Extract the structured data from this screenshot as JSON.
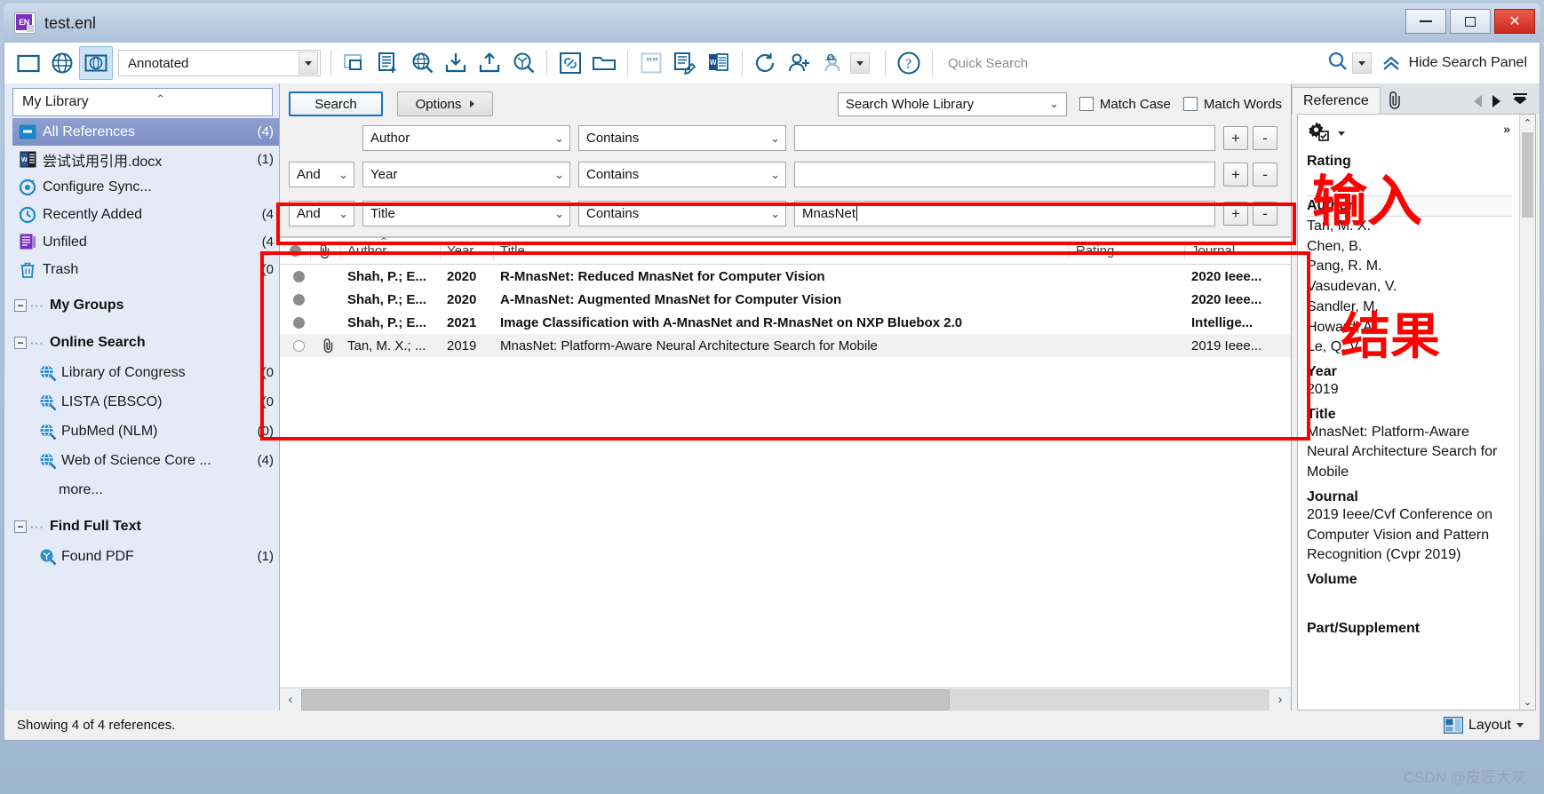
{
  "window": {
    "title": "test.enl",
    "app_badge": "EN",
    "minimize": "—",
    "maximize": "□",
    "close": "✕"
  },
  "toolbar": {
    "style_value": "Annotated",
    "quick_search_placeholder": "Quick Search",
    "hide_search_panel": "Hide Search Panel",
    "icons": [
      {
        "name": "new-library-icon",
        "glyph": "folder"
      },
      {
        "name": "online-search-icon",
        "glyph": "globe"
      },
      {
        "name": "integrated-library-search-icon",
        "glyph": "globe-folder"
      },
      {
        "name": "copy-references-icon",
        "glyph": "copy"
      },
      {
        "name": "new-reference-icon",
        "glyph": "doc-plus"
      },
      {
        "name": "online-search-mode-icon",
        "glyph": "globe-search"
      },
      {
        "name": "import-icon",
        "glyph": "down-arrow-tray"
      },
      {
        "name": "export-icon",
        "glyph": "up-arrow-tray"
      },
      {
        "name": "find-full-text-icon",
        "glyph": "pdf-search"
      },
      {
        "name": "open-url-link-icon",
        "glyph": "link"
      },
      {
        "name": "open-file-icon",
        "glyph": "open-folder"
      },
      {
        "name": "insert-citation-icon",
        "glyph": "quote"
      },
      {
        "name": "format-bibliography-icon",
        "glyph": "doc-pencil"
      },
      {
        "name": "word-addin-icon",
        "glyph": "word"
      },
      {
        "name": "sync-icon",
        "glyph": "sync"
      },
      {
        "name": "share-library-icon",
        "glyph": "person-plus"
      },
      {
        "name": "activity-feed-icon",
        "glyph": "person-bell"
      },
      {
        "name": "help-icon",
        "glyph": "question"
      }
    ]
  },
  "sidebar": {
    "library_header": "My Library",
    "items": [
      {
        "label": "All References",
        "count": "(4)",
        "icon": "all-references-icon",
        "selected": true
      },
      {
        "label": "尝试试用引用.docx",
        "count": "(1)",
        "icon": "word-doc-icon",
        "selected": false
      },
      {
        "label": "Configure Sync...",
        "count": "",
        "icon": "sync-config-icon",
        "selected": false
      },
      {
        "label": "Recently Added",
        "count": "(4",
        "icon": "recently-added-icon",
        "selected": false
      },
      {
        "label": "Unfiled",
        "count": "(4",
        "icon": "unfiled-icon",
        "selected": false
      },
      {
        "label": "Trash",
        "count": "(0",
        "icon": "trash-icon",
        "selected": false
      }
    ],
    "groups": [
      {
        "title": "My Groups",
        "children": []
      },
      {
        "title": "Online Search",
        "children": [
          {
            "label": "Library of Congress",
            "count": "(0",
            "icon": "online-search-icon"
          },
          {
            "label": "LISTA (EBSCO)",
            "count": "(0",
            "icon": "online-search-icon"
          },
          {
            "label": "PubMed (NLM)",
            "count": "(0)",
            "icon": "online-search-icon"
          },
          {
            "label": "Web of Science Core ...",
            "count": "(4)",
            "icon": "online-search-icon"
          }
        ],
        "more": "more..."
      },
      {
        "title": "Find Full Text",
        "children": [
          {
            "label": "Found PDF",
            "count": "(1)",
            "icon": "found-pdf-icon"
          }
        ]
      }
    ]
  },
  "search_panel": {
    "search_button": "Search",
    "options_button": "Options",
    "scope_value": "Search Whole Library",
    "match_case_label": "Match Case",
    "match_words_label": "Match Words",
    "rows": [
      {
        "bool": "",
        "field": "Author",
        "operator": "Contains",
        "term": "",
        "add": "+",
        "remove": "-"
      },
      {
        "bool": "And",
        "field": "Year",
        "operator": "Contains",
        "term": "",
        "add": "+",
        "remove": "-"
      },
      {
        "bool": "And",
        "field": "Title",
        "operator": "Contains",
        "term": "MnasNet",
        "add": "+",
        "remove": "-"
      }
    ]
  },
  "results_table": {
    "columns": [
      "",
      "",
      "Author",
      "Year",
      "Title",
      "Rating",
      "Journal"
    ],
    "column_labels": {
      "author": "Author",
      "year": "Year",
      "title": "Title",
      "rating": "Rating",
      "journal": "Journal"
    },
    "rows": [
      {
        "read": "unread",
        "attachment": false,
        "author": "Shah, P.; E...",
        "year": "2020",
        "title": "R-MnasNet: Reduced MnasNet for Computer Vision",
        "rating": "",
        "journal": "2020 Ieee...",
        "selected": false
      },
      {
        "read": "unread",
        "attachment": false,
        "author": "Shah, P.; E...",
        "year": "2020",
        "title": "A-MnasNet: Augmented MnasNet for Computer Vision",
        "rating": "",
        "journal": "2020 Ieee...",
        "selected": false
      },
      {
        "read": "unread",
        "attachment": false,
        "author": "Shah, P.; E...",
        "year": "2021",
        "title": "Image Classification with A-MnasNet and R-MnasNet on NXP Bluebox 2.0",
        "rating": "",
        "journal": "Intellige...",
        "selected": false
      },
      {
        "read": "read",
        "attachment": true,
        "author": "Tan, M. X.; ...",
        "year": "2019",
        "title": "MnasNet: Platform-Aware Neural Architecture Search for Mobile",
        "rating": "",
        "journal": "2019 Ieee...",
        "selected": true
      }
    ]
  },
  "reference_panel": {
    "tab_label": "Reference",
    "fields": [
      {
        "label": "Rating",
        "value": ""
      },
      {
        "label": "Author",
        "value": "Tan, M. X.\nChen, B.\nPang, R. M.\nVasudevan, V.\nSandler, M.\nHoward, A.\nLe, Q. V."
      },
      {
        "label": "Year",
        "value": "2019"
      },
      {
        "label": "Title",
        "value": "MnasNet: Platform-Aware Neural Architecture Search for Mobile"
      },
      {
        "label": "Journal",
        "value": "2019 Ieee/Cvf Conference on Computer Vision and Pattern Recognition (Cvpr 2019)"
      },
      {
        "label": "Volume",
        "value": ""
      },
      {
        "label": "Part/Supplement",
        "value": ""
      }
    ],
    "authors": [
      "Tan, M. X.",
      "Chen, B.",
      "Pang, R. M.",
      "Vasudevan, V.",
      "Sandler, M.",
      "Howard, A.",
      "Le, Q. V."
    ],
    "expand_glyph": "»"
  },
  "status_bar": {
    "text": "Showing 4 of 4 references.",
    "layout_label": "Layout"
  },
  "annotations": {
    "input_label": "输入",
    "result_label": "结果",
    "highlight_color": "#ff0000"
  },
  "watermark": "CSDN @皮匠大灰"
}
